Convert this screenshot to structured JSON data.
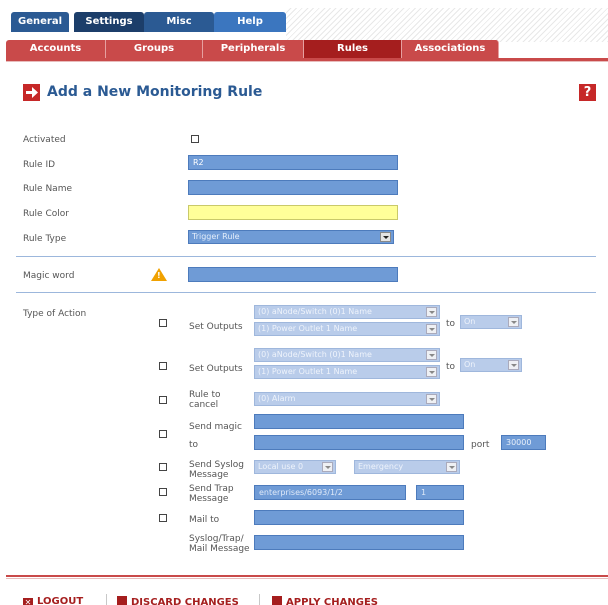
{
  "top_tabs": [
    "General",
    "Settings",
    "Misc",
    "Help"
  ],
  "sub_tabs": [
    "Accounts",
    "Groups",
    "Peripherals",
    "Rules",
    "Associations"
  ],
  "heading": "Add a New Monitoring Rule",
  "help_glyph": "?",
  "warning_glyph": "!",
  "form": {
    "activated_label": "Activated",
    "rule_id_label": "Rule ID",
    "rule_id_value": "R2",
    "rule_name_label": "Rule Name",
    "rule_color_label": "Rule Color",
    "rule_type_label": "Rule Type",
    "rule_type_value": "Trigger Rule",
    "magic_word_label": "Magic word",
    "type_of_action_label": "Type of Action"
  },
  "actions": {
    "set_outputs_label": "Set Outputs",
    "to_label": "to",
    "set1_sel1": "(0) aNode/Switch (0)1 Name",
    "set1_sel2": "(1) Power Outlet 1 Name",
    "set1_to": "On",
    "set2_sel1": "(0) aNode/Switch (0)1 Name",
    "set2_sel2": "(1) Power Outlet 1 Name",
    "set2_to": "On",
    "rule_to_cancel_label": "Rule to\ncancel",
    "rule_to_cancel_value": "(0) Alarm",
    "send_magic_label": "Send magic",
    "to_label2": "to",
    "port_label": "port",
    "port_value": "30000",
    "send_syslog_label": "Send Syslog\nMessage",
    "syslog_facility": "Local use 0",
    "syslog_severity": "Emergency",
    "send_trap_label": "Send Trap\nMessage",
    "trap_oid": "enterprises/6093/1/2",
    "trap_field2": "1",
    "mail_to_label": "Mail to",
    "message_label": "Syslog/Trap/\nMail Message"
  },
  "bottom": {
    "logout": "LOGOUT",
    "discard": "DISCARD CHANGES",
    "apply": "APPLY CHANGES"
  },
  "colors": {
    "nav_blue": "#2b5a93",
    "tab_red": "#c94a4a",
    "active_red": "#a51e1e",
    "field_blue": "#6f9bd6",
    "color_field": "#ffff99"
  }
}
